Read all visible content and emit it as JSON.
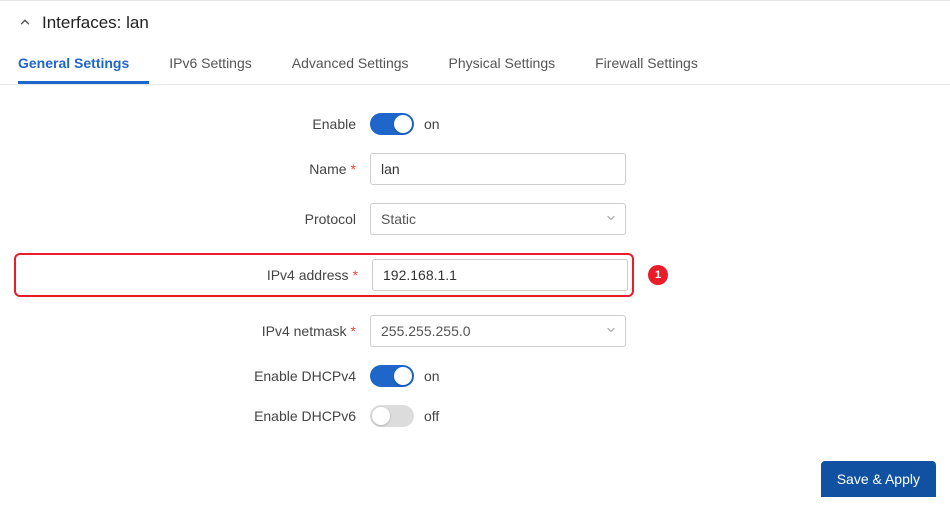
{
  "header": {
    "title": "Interfaces: lan"
  },
  "tabs": [
    {
      "label": "General Settings",
      "active": true
    },
    {
      "label": "IPv6 Settings"
    },
    {
      "label": "Advanced Settings"
    },
    {
      "label": "Physical Settings"
    },
    {
      "label": "Firewall Settings"
    }
  ],
  "form": {
    "enable": {
      "label": "Enable",
      "state": "on",
      "on": true
    },
    "name": {
      "label": "Name",
      "required": true,
      "value": "lan"
    },
    "protocol": {
      "label": "Protocol",
      "value": "Static"
    },
    "ipv4_address": {
      "label": "IPv4 address",
      "required": true,
      "value": "192.168.1.1",
      "annotation": "1"
    },
    "ipv4_netmask": {
      "label": "IPv4 netmask",
      "required": true,
      "value": "255.255.255.0"
    },
    "enable_dhcpv4": {
      "label": "Enable DHCPv4",
      "state": "on",
      "on": true
    },
    "enable_dhcpv6": {
      "label": "Enable DHCPv6",
      "state": "off",
      "on": false
    }
  },
  "actions": {
    "save_apply": "Save & Apply"
  }
}
